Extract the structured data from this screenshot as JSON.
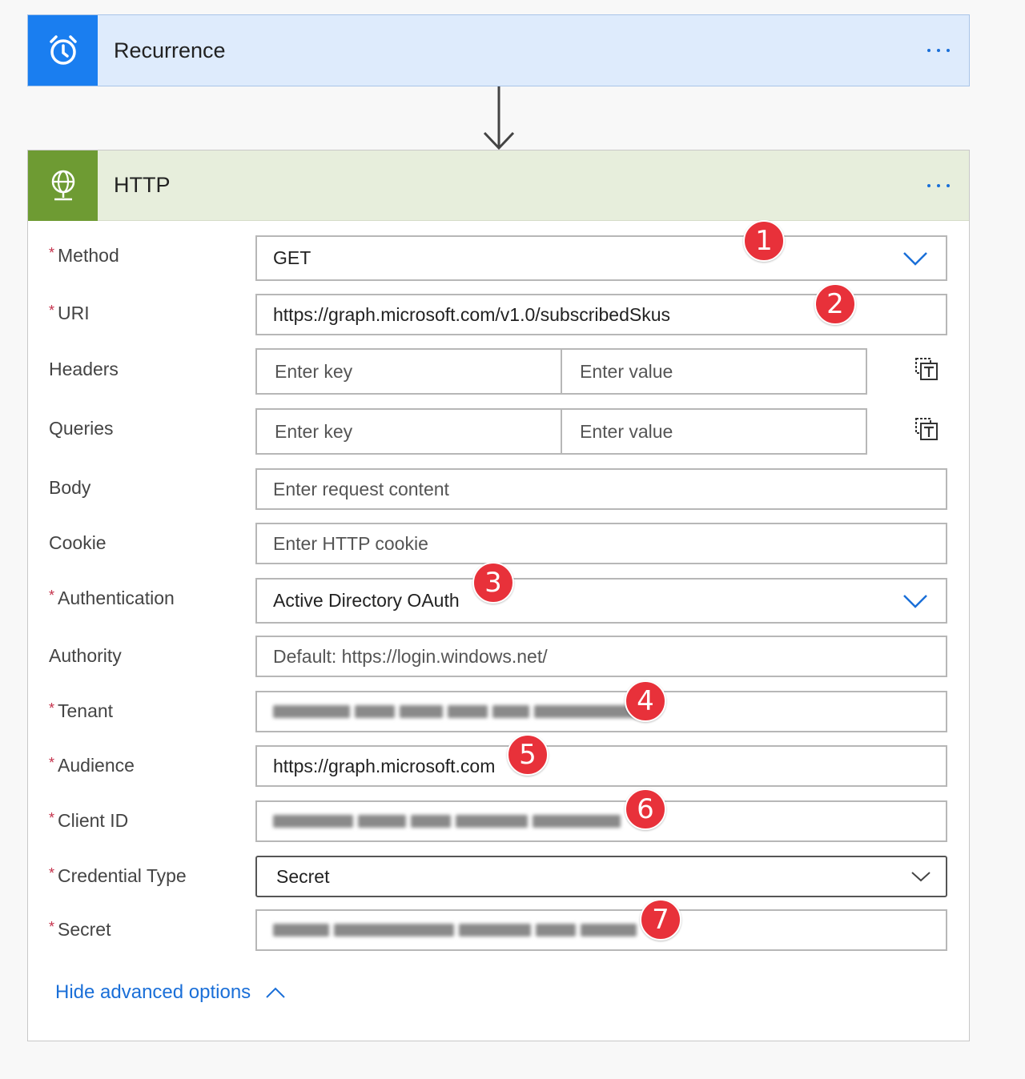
{
  "trigger": {
    "title": "Recurrence",
    "icon": "alarm-clock-icon"
  },
  "action": {
    "title": "HTTP",
    "icon": "globe-icon",
    "fields": {
      "method": {
        "label": "Method",
        "required": true,
        "value": "GET"
      },
      "uri": {
        "label": "URI",
        "required": true,
        "value": "https://graph.microsoft.com/v1.0/subscribedSkus"
      },
      "headers": {
        "label": "Headers",
        "key_placeholder": "Enter key",
        "value_placeholder": "Enter value"
      },
      "queries": {
        "label": "Queries",
        "key_placeholder": "Enter key",
        "value_placeholder": "Enter value"
      },
      "body": {
        "label": "Body",
        "placeholder": "Enter request content"
      },
      "cookie": {
        "label": "Cookie",
        "placeholder": "Enter HTTP cookie"
      },
      "authentication": {
        "label": "Authentication",
        "required": true,
        "value": "Active Directory OAuth"
      },
      "authority": {
        "label": "Authority",
        "placeholder": "Default: https://login.windows.net/"
      },
      "tenant": {
        "label": "Tenant",
        "required": true
      },
      "audience": {
        "label": "Audience",
        "required": true,
        "value": "https://graph.microsoft.com"
      },
      "client_id": {
        "label": "Client ID",
        "required": true
      },
      "credential_type": {
        "label": "Credential Type",
        "required": true,
        "value": "Secret"
      },
      "secret": {
        "label": "Secret",
        "required": true
      }
    },
    "advanced_link": "Hide advanced options"
  },
  "annotations": [
    "1",
    "2",
    "3",
    "4",
    "5",
    "6",
    "7"
  ],
  "colors": {
    "trigger_accent": "#1a7ef0",
    "trigger_header_bg": "#deebfc",
    "action_accent": "#6e9b33",
    "action_header_bg": "#e7eedc",
    "link": "#1a6fd8",
    "badge": "#e8313a",
    "required": "#c4314b"
  }
}
